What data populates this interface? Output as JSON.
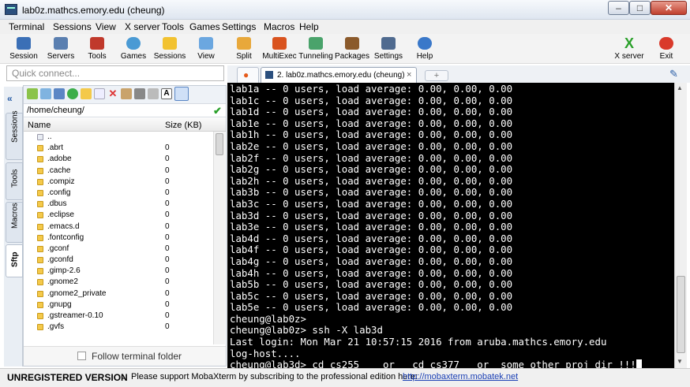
{
  "window": {
    "title": "lab0z.mathcs.emory.edu (cheung)"
  },
  "menu": [
    "Terminal",
    "Sessions",
    "View",
    "X server",
    "Tools",
    "Games",
    "Settings",
    "Macros",
    "Help"
  ],
  "toolbar": {
    "left": [
      "Session",
      "Servers",
      "Tools",
      "Games",
      "Sessions",
      "View",
      "Split",
      "MultiExec",
      "Tunneling",
      "Packages",
      "Settings",
      "Help"
    ],
    "xserver": "X server",
    "exit": "Exit"
  },
  "quick_connect": {
    "placeholder": "Quick connect..."
  },
  "side_tabs": [
    "Sessions",
    "Tools",
    "Macros",
    "Sftp"
  ],
  "sftp": {
    "path": "/home/cheung/",
    "columns": {
      "name": "Name",
      "size": "Size (KB)"
    },
    "files": [
      {
        "name": "..",
        "size": ""
      },
      {
        "name": ".abrt",
        "size": "0"
      },
      {
        "name": ".adobe",
        "size": "0"
      },
      {
        "name": ".cache",
        "size": "0"
      },
      {
        "name": ".compiz",
        "size": "0"
      },
      {
        "name": ".config",
        "size": "0"
      },
      {
        "name": ".dbus",
        "size": "0"
      },
      {
        "name": ".eclipse",
        "size": "0"
      },
      {
        "name": ".emacs.d",
        "size": "0"
      },
      {
        "name": ".fontconfig",
        "size": "0"
      },
      {
        "name": ".gconf",
        "size": "0"
      },
      {
        "name": ".gconfd",
        "size": "0"
      },
      {
        "name": ".gimp-2.6",
        "size": "0"
      },
      {
        "name": ".gnome2",
        "size": "0"
      },
      {
        "name": ".gnome2_private",
        "size": "0"
      },
      {
        "name": ".gnupg",
        "size": "0"
      },
      {
        "name": ".gstreamer-0.10",
        "size": "0"
      },
      {
        "name": ".gvfs",
        "size": "0"
      }
    ],
    "follow_label": "Follow terminal folder"
  },
  "terminal_tab": {
    "label": "2. lab0z.mathcs.emory.edu (cheung)"
  },
  "terminal_lines": [
    "lab1a -- 0 users, load average: 0.00, 0.00, 0.00",
    "lab1c -- 0 users, load average: 0.00, 0.00, 0.00",
    "lab1d -- 0 users, load average: 0.00, 0.00, 0.00",
    "lab1e -- 0 users, load average: 0.00, 0.00, 0.00",
    "lab1h -- 0 users, load average: 0.00, 0.00, 0.00",
    "lab2e -- 0 users, load average: 0.00, 0.00, 0.00",
    "lab2f -- 0 users, load average: 0.00, 0.00, 0.00",
    "lab2g -- 0 users, load average: 0.00, 0.00, 0.00",
    "lab2h -- 0 users, load average: 0.00, 0.00, 0.00",
    "lab3b -- 0 users, load average: 0.00, 0.00, 0.00",
    "lab3c -- 0 users, load average: 0.00, 0.00, 0.00",
    "lab3d -- 0 users, load average: 0.00, 0.00, 0.00",
    "lab3e -- 0 users, load average: 0.00, 0.00, 0.00",
    "lab4d -- 0 users, load average: 0.00, 0.00, 0.00",
    "lab4f -- 0 users, load average: 0.00, 0.00, 0.00",
    "lab4g -- 0 users, load average: 0.00, 0.00, 0.00",
    "lab4h -- 0 users, load average: 0.00, 0.00, 0.00",
    "lab5b -- 0 users, load average: 0.00, 0.00, 0.00",
    "lab5c -- 0 users, load average: 0.00, 0.00, 0.00",
    "lab5e -- 0 users, load average: 0.00, 0.00, 0.00",
    "cheung@lab0z>",
    "cheung@lab0z> ssh -X lab3d",
    "Last login: Mon Mar 21 10:57:15 2016 from aruba.mathcs.emory.edu",
    "log-host....",
    "cheung@lab3d> cd cs255    or   cd cs377   or  some other proj dir !!!"
  ],
  "status": {
    "unregistered": "UNREGISTERED VERSION",
    "dash": "-",
    "message": "Please support MobaXterm by subscribing to the professional edition here:",
    "link": "http://mobaxterm.mobatek.net"
  },
  "colors": {
    "terminal_bg": "#000000",
    "terminal_fg": "#ffffff",
    "link": "#1a3fb4"
  }
}
